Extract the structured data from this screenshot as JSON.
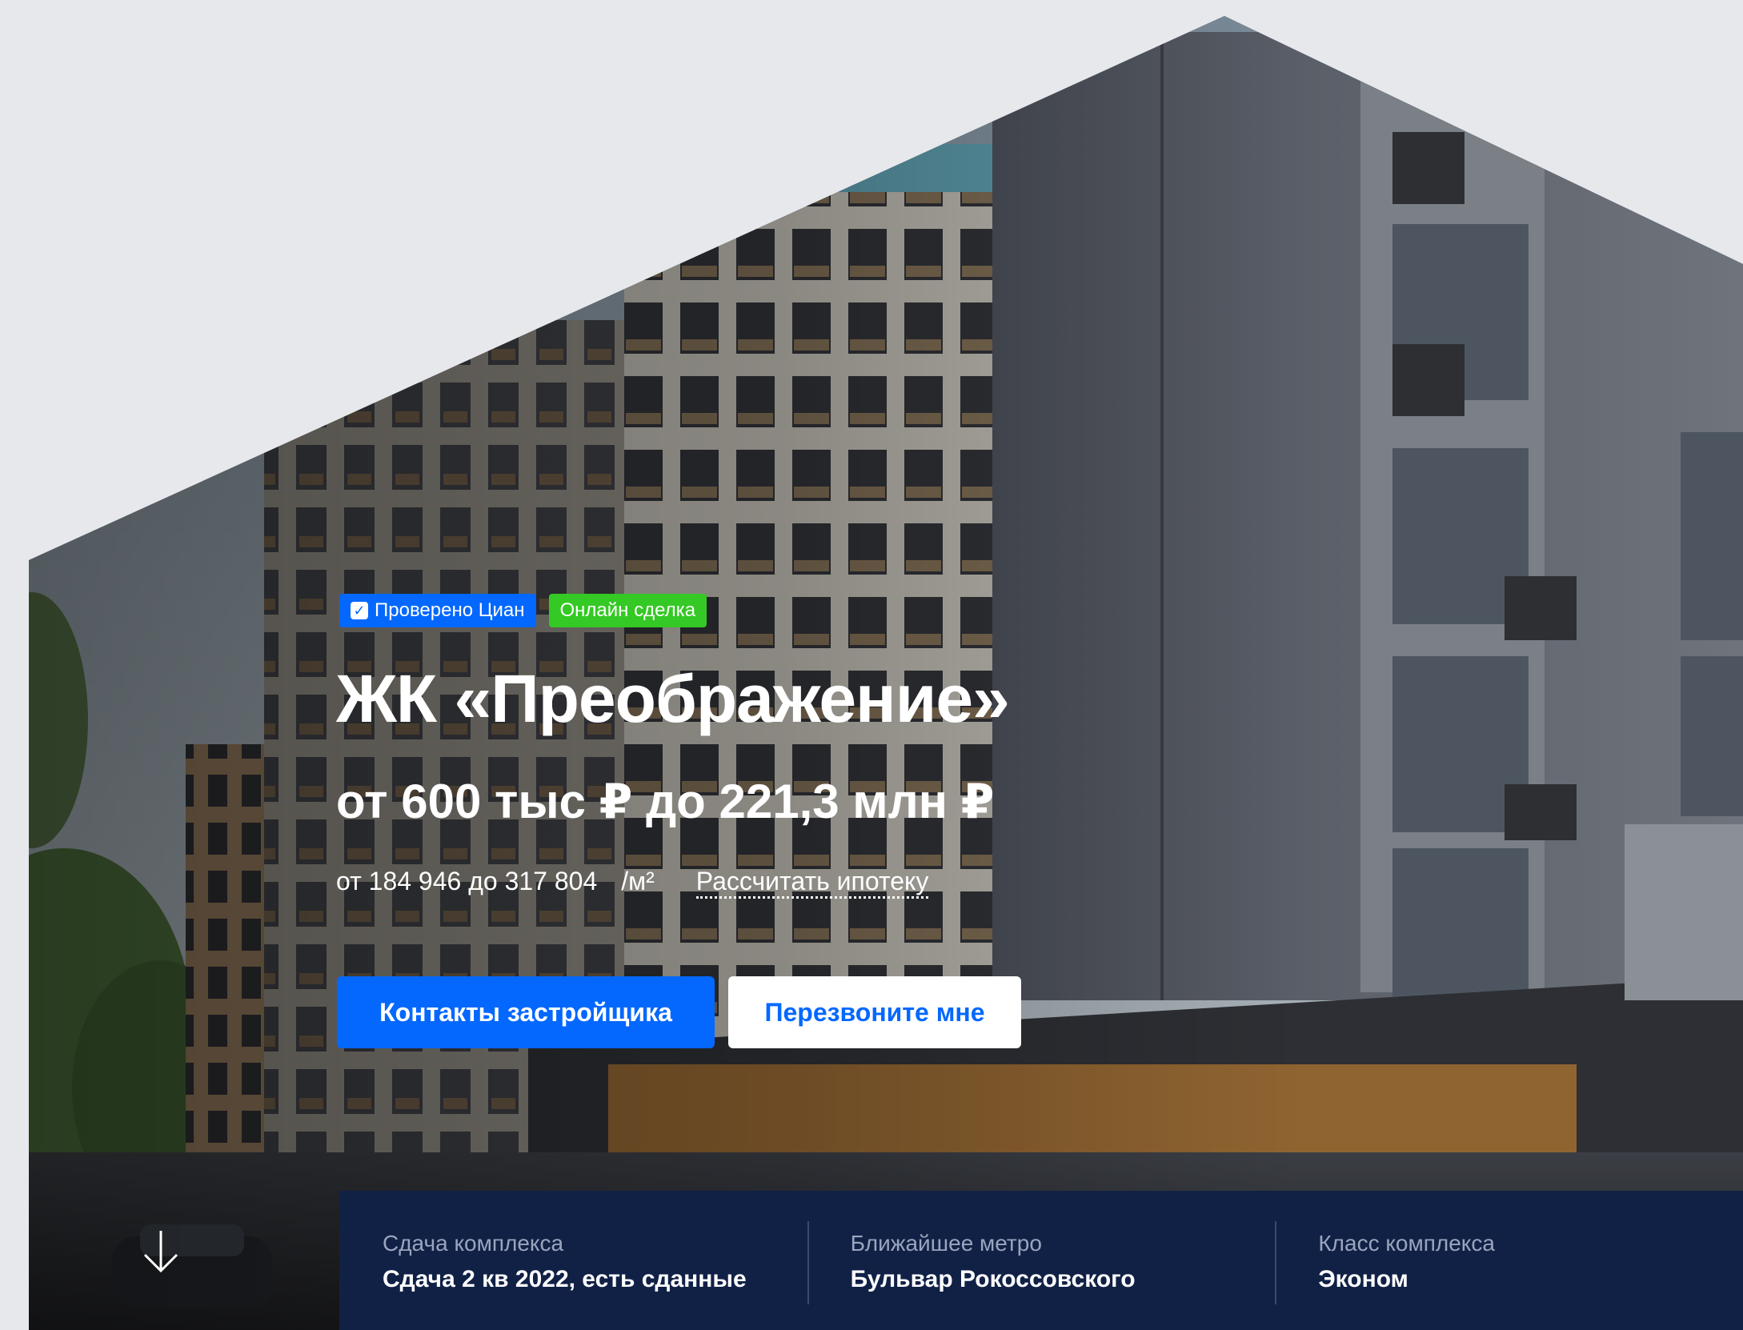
{
  "hero": {
    "badges": {
      "verified": "Проверено Циан",
      "online": "Онлайн сделка"
    },
    "title": "ЖК «Преображение»",
    "price_range": "от 600 тыс ₽ до 221,3 млн ₽",
    "price_per_sqm": "от 184 946 до 317 804",
    "price_per_sqm_unit": "/м²",
    "mortgage_link": "Рассчитать ипотеку",
    "buttons": {
      "contacts": "Контакты застройщика",
      "callback": "Перезвоните мне"
    },
    "scroll_icon": "arrow-down-icon"
  },
  "info": [
    {
      "label": "Сдача комплекса",
      "value": "Сдача 2 кв 2022, есть сданные"
    },
    {
      "label": "Ближайшее метро",
      "value": "Бульвар Рокоссовского"
    },
    {
      "label": "Класс комплекса",
      "value": "Эконом"
    }
  ],
  "colors": {
    "accent": "#0468ff",
    "online_badge": "#34c924",
    "info_bar": "#112146",
    "page_bg": "#e6e8ec"
  }
}
